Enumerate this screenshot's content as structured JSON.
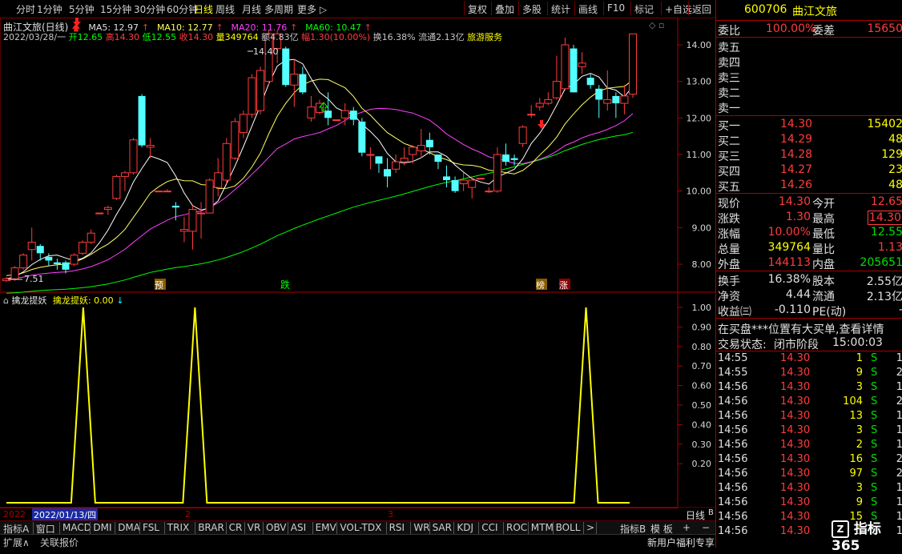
{
  "toolbar": {
    "periods": [
      "分时",
      "1分钟",
      "5分钟",
      "15分钟",
      "30分钟",
      "60分钟",
      "日线",
      "周线",
      "月线",
      "多周期",
      "更多 ▷"
    ],
    "selected": "日线",
    "actions": [
      "复权",
      "叠加",
      "多股",
      "统计",
      "画线",
      "F10",
      "标记",
      "+自选",
      "返回"
    ]
  },
  "chart_header": {
    "name": "曲江文旅(日线)",
    "ma5": "MA5: 12.97",
    "ma10": "MA10: 12.77",
    "ma20": "MA20: 11.76",
    "ma60": "MA60: 10.47",
    "info_date": "2022/03/28/一",
    "info_open": "开12.65",
    "info_high": "高14.30",
    "info_low": "低12.55",
    "info_close": "收14.30",
    "info_vol": "量349764",
    "info_amt": "额4.83亿",
    "info_chg": "幅1.30(10.00%)",
    "info_turn": "换16.38%",
    "info_float": "流通2.13亿",
    "info_sector": "旅游服务"
  },
  "price_axis": [
    "14.00",
    "13.00",
    "12.00",
    "11.00",
    "10.00",
    "9.00",
    "8.00"
  ],
  "indicator_axis": [
    "1.00",
    "0.90",
    "0.80",
    "0.70",
    "0.60",
    "0.50",
    "0.40",
    "0.30",
    "0.20"
  ],
  "annotations": {
    "high": "14.40",
    "low": "7.51",
    "tag_yu": "预",
    "tag_die": "跌",
    "tag_bang": "榜",
    "tag_zhang": "涨"
  },
  "indicator": {
    "name": "擒龙提妖",
    "value_label": "擒龙提妖: 0.00",
    "peaks": [
      {
        "date_index": 11,
        "value": 1.0
      },
      {
        "date_index": 27,
        "value": 1.0
      },
      {
        "date_index": 83,
        "value": 1.0
      }
    ]
  },
  "time_axis": {
    "left_date": "2022",
    "cursor_date": "2022/01/13/四",
    "month2": "2",
    "month3": "3",
    "period_label": "日线",
    "period_flag": "B"
  },
  "bottom_tabs": [
    "指标A",
    "窗口",
    "MACD",
    "DMI",
    "DMA",
    "FSL",
    "TRIX",
    "BRAR",
    "CR",
    "VR",
    "OBV",
    "ASI",
    "EMV",
    "VOL-TDX",
    "RSI",
    "WR",
    "SAR",
    "KDJ",
    "CCI",
    "ROC",
    "MTM",
    "BOLL",
    ">"
  ],
  "bottom_right_tabs": [
    "指标B",
    "模 板",
    "+",
    "−"
  ],
  "status": {
    "expand": "扩展∧",
    "report": "关联报价",
    "promo": "新用户福利专享",
    "brand": "指标365"
  },
  "quote": {
    "code": "600706",
    "name": "曲江文旅",
    "weibi_label": "委比",
    "weibi_value": "100.00%",
    "weicha_label": "委差",
    "weicha_value": "15650",
    "sells": [
      {
        "label": "卖五",
        "price": "",
        "vol": ""
      },
      {
        "label": "卖四",
        "price": "",
        "vol": ""
      },
      {
        "label": "卖三",
        "price": "",
        "vol": ""
      },
      {
        "label": "卖二",
        "price": "",
        "vol": ""
      },
      {
        "label": "卖一",
        "price": "",
        "vol": ""
      }
    ],
    "buys": [
      {
        "label": "买一",
        "price": "14.30",
        "vol": "15402"
      },
      {
        "label": "买二",
        "price": "14.29",
        "vol": "48"
      },
      {
        "label": "买三",
        "price": "14.28",
        "vol": "129"
      },
      {
        "label": "买四",
        "price": "14.27",
        "vol": "23"
      },
      {
        "label": "买五",
        "price": "14.26",
        "vol": "48"
      }
    ],
    "stats": [
      {
        "l1": "现价",
        "v1": "14.30",
        "l2": "今开",
        "v2": "12.65"
      },
      {
        "l1": "涨跌",
        "v1": "1.30",
        "l2": "最高",
        "v2": "14.30"
      },
      {
        "l1": "涨幅",
        "v1": "10.00%",
        "l2": "最低",
        "v2": "12.55"
      },
      {
        "l1": "总量",
        "v1": "349764",
        "l2": "量比",
        "v2": "1.13"
      },
      {
        "l1": "外盘",
        "v1": "144113",
        "l2": "内盘",
        "v2": "205651"
      }
    ],
    "stats2": [
      {
        "l1": "换手",
        "v1": "16.38%",
        "l2": "股本",
        "v2": "2.55亿"
      },
      {
        "l1": "净资",
        "v1": "4.44",
        "l2": "流通",
        "v2": "2.13亿"
      },
      {
        "l1": "收益㈢",
        "v1": "-0.110",
        "l2": "PE(动)",
        "v2": "-"
      }
    ],
    "notice": "在买盘***位置有大买单,查看详情",
    "state_label": "交易状态:",
    "state_value": "闭市阶段",
    "state_time": "15:00:03",
    "ticks": [
      {
        "t": "14:55",
        "p": "14.30",
        "v": "1",
        "d": "S",
        "n": "1"
      },
      {
        "t": "14:55",
        "p": "14.30",
        "v": "9",
        "d": "S",
        "n": "2"
      },
      {
        "t": "14:56",
        "p": "14.30",
        "v": "3",
        "d": "S",
        "n": "1"
      },
      {
        "t": "14:56",
        "p": "14.30",
        "v": "104",
        "d": "S",
        "n": "2"
      },
      {
        "t": "14:56",
        "p": "14.30",
        "v": "13",
        "d": "S",
        "n": "1"
      },
      {
        "t": "14:56",
        "p": "14.30",
        "v": "3",
        "d": "S",
        "n": "1"
      },
      {
        "t": "14:56",
        "p": "14.30",
        "v": "2",
        "d": "S",
        "n": "1"
      },
      {
        "t": "14:56",
        "p": "14.30",
        "v": "16",
        "d": "S",
        "n": "2"
      },
      {
        "t": "14:56",
        "p": "14.30",
        "v": "97",
        "d": "S",
        "n": "2"
      },
      {
        "t": "14:56",
        "p": "14.30",
        "v": "3",
        "d": "S",
        "n": "1"
      },
      {
        "t": "14:56",
        "p": "14.30",
        "v": "9",
        "d": "S",
        "n": "1"
      },
      {
        "t": "14:56",
        "p": "14.30",
        "v": "15",
        "d": "S",
        "n": "1"
      },
      {
        "t": "14:56",
        "p": "14.30",
        "v": "3",
        "d": "S",
        "n": "1"
      }
    ]
  },
  "chart_data": {
    "type": "candlestick",
    "price_range": [
      7.3,
      14.7
    ],
    "candles": [
      [
        7.55,
        7.6,
        7.51,
        7.65
      ],
      [
        7.6,
        7.9,
        7.55,
        7.95
      ],
      [
        7.9,
        8.25,
        7.85,
        8.3
      ],
      [
        8.4,
        8.6,
        8.1,
        9.0
      ],
      [
        8.5,
        8.3,
        8.1,
        8.55
      ],
      [
        8.2,
        8.1,
        7.95,
        8.3
      ],
      [
        8.05,
        8.0,
        7.85,
        8.15
      ],
      [
        8.05,
        7.85,
        7.75,
        8.1
      ],
      [
        8.0,
        8.25,
        7.95,
        8.3
      ],
      [
        8.3,
        8.6,
        8.25,
        8.65
      ],
      [
        8.6,
        8.85,
        8.55,
        8.95
      ],
      [
        9.4,
        9.4,
        9.4,
        9.4
      ],
      [
        9.5,
        9.55,
        9.35,
        9.6
      ],
      [
        9.8,
        10.4,
        9.75,
        10.45
      ],
      [
        10.4,
        10.5,
        10.0,
        10.55
      ],
      [
        10.5,
        11.4,
        10.45,
        11.45
      ],
      [
        12.6,
        11.25,
        11.2,
        12.65
      ],
      [
        11.2,
        11.25,
        10.9,
        11.45
      ],
      [
        10.0,
        10.0,
        10.0,
        10.0
      ],
      [
        10.0,
        10.0,
        10.0,
        10.05
      ],
      [
        9.6,
        9.55,
        9.2,
        9.7
      ],
      [
        8.9,
        8.95,
        8.6,
        9.3
      ],
      [
        8.9,
        9.5,
        8.4,
        9.6
      ],
      [
        9.4,
        9.4,
        8.7,
        9.7
      ],
      [
        9.4,
        10.3,
        9.4,
        10.35
      ],
      [
        10.1,
        10.5,
        9.85,
        10.9
      ],
      [
        10.3,
        11.3,
        10.2,
        11.45
      ],
      [
        10.9,
        11.9,
        10.85,
        12.0
      ],
      [
        11.6,
        12.1,
        11.45,
        12.2
      ],
      [
        12.1,
        13.1,
        12.0,
        13.2
      ],
      [
        12.2,
        13.3,
        12.1,
        13.4
      ],
      [
        13.0,
        14.3,
        12.9,
        14.4
      ],
      [
        13.9,
        14.3,
        13.5,
        14.4
      ],
      [
        13.9,
        12.9,
        12.85,
        13.95
      ],
      [
        12.9,
        13.2,
        12.3,
        13.6
      ],
      [
        13.2,
        12.7,
        12.65,
        13.4
      ],
      [
        12.0,
        12.3,
        11.9,
        12.6
      ],
      [
        12.15,
        12.4,
        12.1,
        12.5
      ],
      [
        12.2,
        12.0,
        11.8,
        12.7
      ],
      [
        11.95,
        11.95,
        11.95,
        11.95
      ],
      [
        12.0,
        12.2,
        11.8,
        12.4
      ],
      [
        12.2,
        11.95,
        11.8,
        12.3
      ],
      [
        11.9,
        11.05,
        10.95,
        12.0
      ],
      [
        11.0,
        11.0,
        10.6,
        11.2
      ],
      [
        10.95,
        10.75,
        10.5,
        10.95
      ],
      [
        10.6,
        10.4,
        10.1,
        10.9
      ],
      [
        10.6,
        10.8,
        10.5,
        11.0
      ],
      [
        10.8,
        10.9,
        10.7,
        11.2
      ],
      [
        11.0,
        11.2,
        10.75,
        11.25
      ],
      [
        11.1,
        11.25,
        10.9,
        11.7
      ],
      [
        11.4,
        11.2,
        11.0,
        11.6
      ],
      [
        11.0,
        10.8,
        10.6,
        11.0
      ],
      [
        10.4,
        10.3,
        10.1,
        10.7
      ],
      [
        10.3,
        10.0,
        9.95,
        10.4
      ],
      [
        10.2,
        10.3,
        10.0,
        10.5
      ],
      [
        10.1,
        10.3,
        9.8,
        10.4
      ],
      [
        10.35,
        10.35,
        10.35,
        10.35
      ],
      [
        10.0,
        10.0,
        9.95,
        10.1
      ],
      [
        10.0,
        11.0,
        9.95,
        11.2
      ],
      [
        11.0,
        10.8,
        10.7,
        11.3
      ],
      [
        10.9,
        10.85,
        10.7,
        11.0
      ],
      [
        11.3,
        11.75,
        11.2,
        11.8
      ],
      [
        12.1,
        12.1,
        12.0,
        12.35
      ],
      [
        12.3,
        12.4,
        12.2,
        12.55
      ],
      [
        12.4,
        12.5,
        12.35,
        12.7
      ],
      [
        12.55,
        13.0,
        12.5,
        13.7
      ],
      [
        12.8,
        14.0,
        12.75,
        14.2
      ],
      [
        13.9,
        12.7,
        12.7,
        14.0
      ],
      [
        13.4,
        13.5,
        13.2,
        13.8
      ],
      [
        13.1,
        12.9,
        12.8,
        13.2
      ],
      [
        12.8,
        12.5,
        12.0,
        12.9
      ],
      [
        12.4,
        12.5,
        12.2,
        13.3
      ],
      [
        12.6,
        12.4,
        12.0,
        12.7
      ],
      [
        12.4,
        12.6,
        12.1,
        12.9
      ],
      [
        12.65,
        14.3,
        12.55,
        14.3
      ]
    ]
  }
}
